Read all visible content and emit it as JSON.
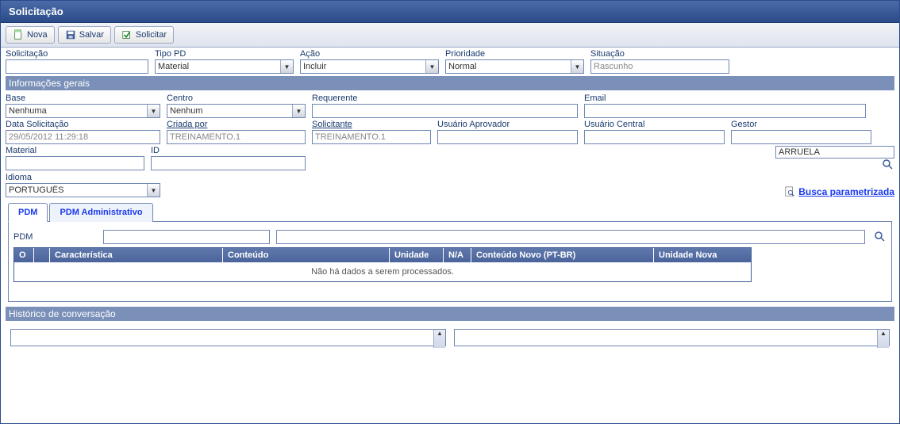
{
  "title": "Solicitação",
  "toolbar": {
    "nova": "Nova",
    "salvar": "Salvar",
    "solicitar": "Solicitar"
  },
  "topFields": {
    "solicitacao_label": "Solicitação",
    "solicitacao_value": "",
    "tipopd_label": "Tipo PD",
    "tipopd_value": "Material",
    "acao_label": "Ação",
    "acao_value": "Incluir",
    "prioridade_label": "Prioridade",
    "prioridade_value": "Normal",
    "situacao_label": "Situação",
    "situacao_value": "Rascunho"
  },
  "sections": {
    "gerais": "Informações gerais",
    "historico": "Histórico de conversação"
  },
  "gerais": {
    "base_label": "Base",
    "base_value": "Nenhuma",
    "centro_label": "Centro",
    "centro_value": "Nenhum",
    "requerente_label": "Requerente",
    "requerente_value": "",
    "email_label": "Email",
    "email_value": "",
    "data_label": "Data Solicitação",
    "data_value": "29/05/2012 11:29:18",
    "criada_label": "Criada por",
    "criada_value": "TREINAMENTO.1",
    "solicitante_label": "Solicitante",
    "solicitante_value": "TREINAMENTO.1",
    "aprovador_label": "Usuário Aprovador",
    "aprovador_value": "",
    "central_label": "Usuário Central",
    "central_value": "",
    "gestor_label": "Gestor",
    "gestor_value": "",
    "material_label": "Material",
    "material_value": "",
    "id_label": "ID",
    "id_value": "",
    "desc_value": "ARRUELA",
    "idioma_label": "Idioma",
    "idioma_value": "PORTUGUÊS",
    "busca_link": "Busca parametrizada"
  },
  "tabs": {
    "pdm": "PDM",
    "pdm_admin": "PDM Administrativo"
  },
  "pdm": {
    "label": "PDM",
    "input1": "",
    "input2": "",
    "col_o": "O",
    "col_blank": "",
    "col_carac": "Característica",
    "col_conteudo": "Conteúdo",
    "col_unidade": "Unidade",
    "col_na": "N/A",
    "col_conteudo_novo": "Conteúdo Novo (PT-BR)",
    "col_unidade_nova": "Unidade Nova",
    "empty": "Não há dados a serem processados."
  }
}
